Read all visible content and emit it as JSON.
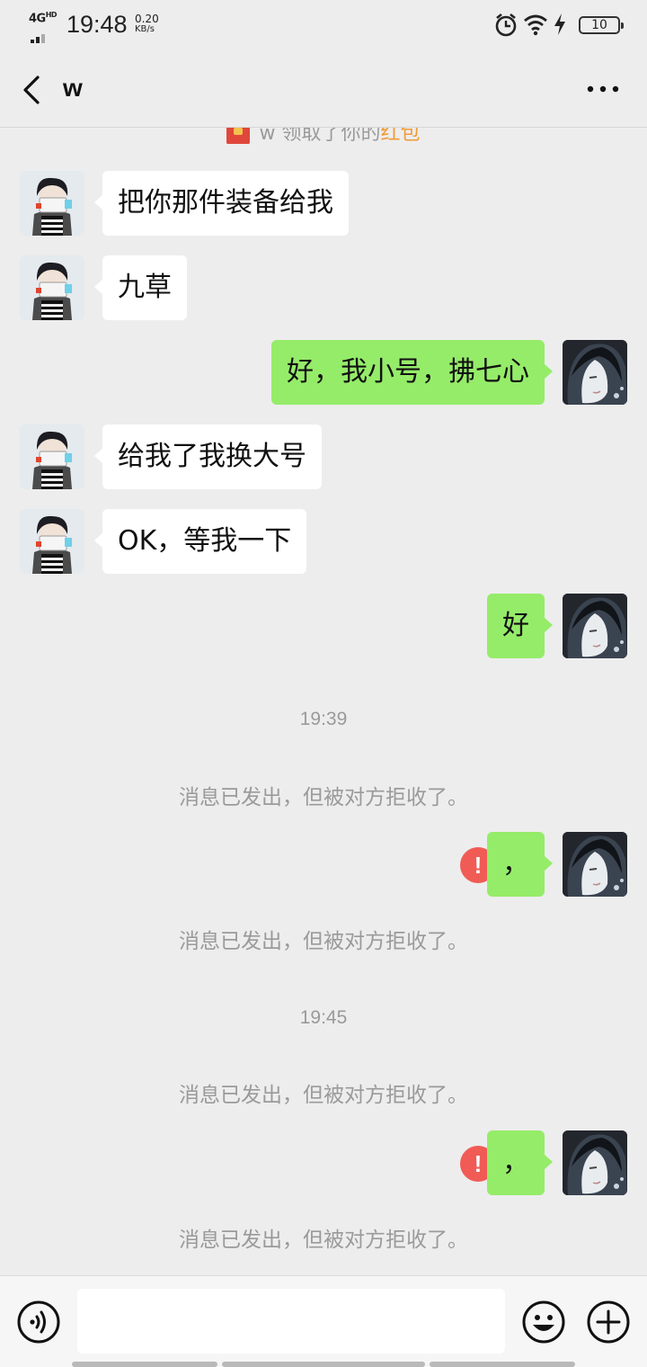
{
  "status_bar": {
    "network": "4G",
    "network_sup": "HD",
    "time": "19:48",
    "speed_value": "0.20",
    "speed_unit": "KB/s",
    "battery": "10"
  },
  "nav": {
    "title": "w"
  },
  "red_packet_notice": {
    "text": "w 领取了你的",
    "link": "红包"
  },
  "messages": [
    {
      "side": "in",
      "text": "把你那件装备给我"
    },
    {
      "side": "in",
      "text": "九草"
    },
    {
      "side": "out",
      "text": "好，我小号，拂七心"
    },
    {
      "side": "in",
      "text": "给我了我换大号"
    },
    {
      "side": "in",
      "text": "OK，等我一下"
    },
    {
      "side": "out",
      "text": "好"
    },
    {
      "timestamp": "19:39"
    },
    {
      "system": "消息已发出，但被对方拒收了。"
    },
    {
      "side": "out",
      "text": "，",
      "failed": true,
      "error_mark": "!"
    },
    {
      "system": "消息已发出，但被对方拒收了。"
    },
    {
      "timestamp": "19:45"
    },
    {
      "system": "消息已发出，但被对方拒收了。"
    },
    {
      "side": "out",
      "text": "，",
      "failed": true,
      "error_mark": "!"
    },
    {
      "system": "消息已发出，但被对方拒收了。"
    }
  ],
  "input_bar": {
    "value": "",
    "placeholder": ""
  },
  "colors": {
    "background": "#ededed",
    "bubble_out": "#95ec69",
    "bubble_in": "#ffffff",
    "error": "#f15b55",
    "link": "#f09a37"
  },
  "icons": {
    "back": "chevron-left-icon",
    "more": "more-dots-icon",
    "voice": "voice-icon",
    "emoji": "emoji-icon",
    "plus": "plus-icon",
    "alarm": "alarm-icon",
    "wifi": "wifi-icon",
    "charging": "charging-icon"
  }
}
